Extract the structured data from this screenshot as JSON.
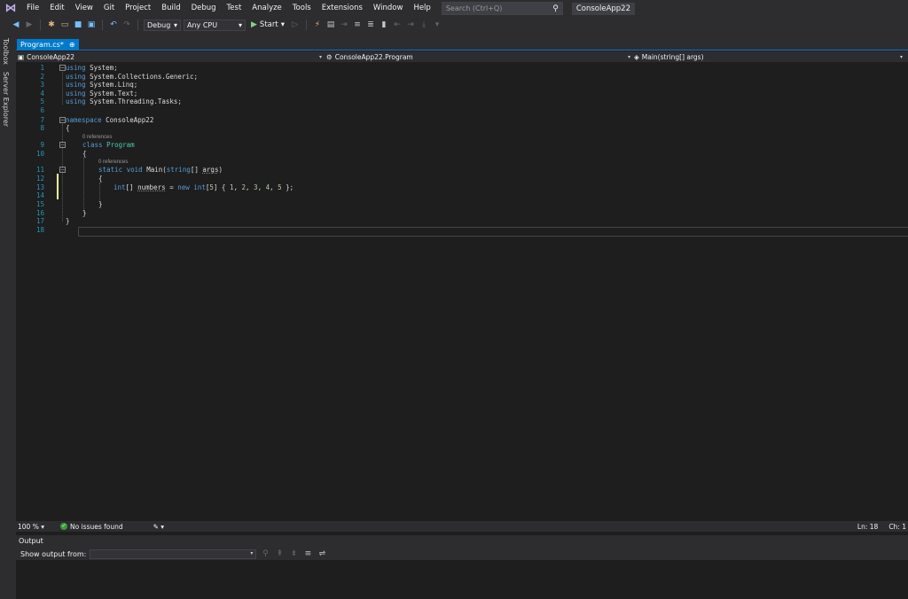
{
  "menu": {
    "items": [
      "File",
      "Edit",
      "View",
      "Git",
      "Project",
      "Build",
      "Debug",
      "Test",
      "Analyze",
      "Tools",
      "Extensions",
      "Window",
      "Help"
    ],
    "search_placeholder": "Search (Ctrl+Q)",
    "solution_title": "ConsoleApp22"
  },
  "toolbar": {
    "config": "Debug",
    "platform": "Any CPU",
    "start_label": "Start"
  },
  "side_tabs": {
    "toolbox": "Toolbox",
    "server_explorer": "Server Explorer"
  },
  "document_tab": {
    "label": "Program.cs*",
    "pin_glyph": "⊕"
  },
  "navigation": {
    "project": "ConsoleApp22",
    "type": "ConsoleApp22.Program",
    "member": "Main(string[] args)"
  },
  "editor": {
    "line_numbers": [
      "1",
      "2",
      "3",
      "4",
      "5",
      "6",
      "7",
      "8",
      "9",
      "10",
      "11",
      "12",
      "13",
      "14",
      "15",
      "16",
      "17",
      "18"
    ],
    "codelens_class": "0 references",
    "codelens_method": "0 references"
  },
  "code": {
    "l1_kw": "using",
    "l1_rest": " System;",
    "l2_kw": "using",
    "l2_rest": " System.Collections.Generic;",
    "l3_kw": "using",
    "l3_rest": " System.Linq;",
    "l4_kw": "using",
    "l4_rest": " System.Text;",
    "l5_kw": "using",
    "l5_rest": " System.Threading.Tasks;",
    "l7_kw": "namespace",
    "l7_rest": " ConsoleApp22",
    "l8": "{",
    "l9_kw": "class",
    "l9_ty": "Program",
    "l10": "{",
    "l11_kw1": "static",
    "l11_kw2": "void",
    "l11_name": "Main(",
    "l11_kw3": "string",
    "l11_mid": "[] ",
    "l11_arg": "args",
    "l11_end": ")",
    "l12": "{",
    "l13_kw1": "int",
    "l13_a": "[] ",
    "l13_var": "numbers",
    "l13_b": " = ",
    "l13_kw2": "new",
    "l13_sp": " ",
    "l13_kw3": "int",
    "l13_c": "[",
    "l13_n5": "5",
    "l13_d": "] { ",
    "l13_v1": "1",
    "l13_e1": ", ",
    "l13_v2": "2",
    "l13_e2": ", ",
    "l13_v3": "3",
    "l13_e3": ", ",
    "l13_v4": "4",
    "l13_e4": ", ",
    "l13_v5": "5",
    "l13_f": " };",
    "l15": "}",
    "l16": "}",
    "l17": "}"
  },
  "status": {
    "zoom": "100 %",
    "issues": "No issues found",
    "line": "Ln: 18",
    "char": "Ch: 1"
  },
  "output": {
    "title": "Output",
    "show_from_label": "Show output from:"
  }
}
